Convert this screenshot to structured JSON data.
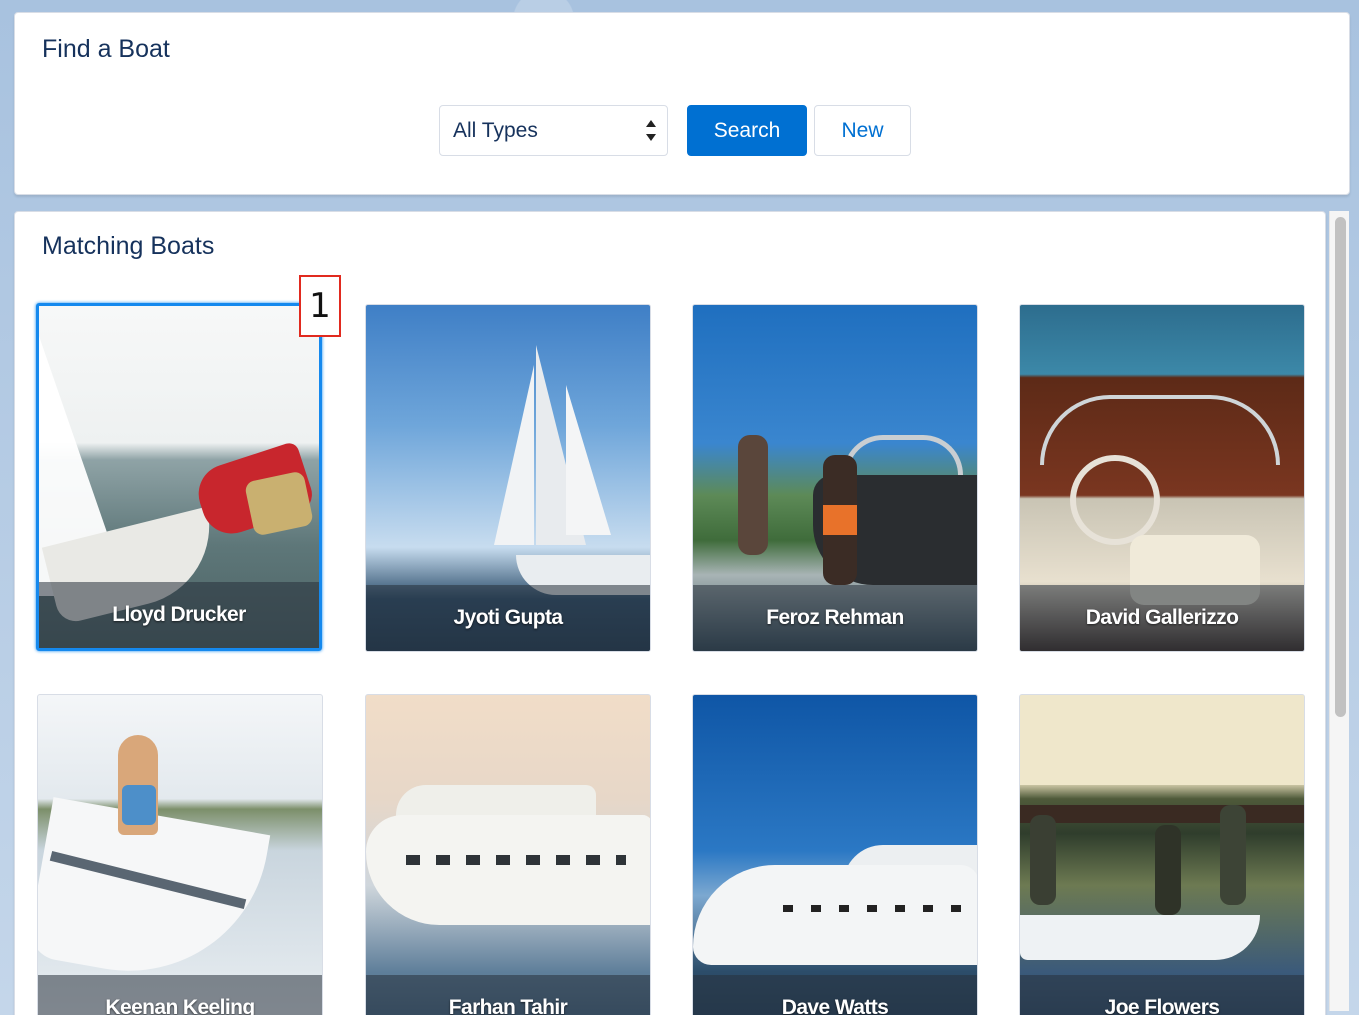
{
  "finder": {
    "title": "Find a Boat",
    "type_select": {
      "value": "All Types"
    },
    "search_label": "Search",
    "new_label": "New"
  },
  "results": {
    "title": "Matching Boats",
    "boats": [
      {
        "name": "Lloyd Drucker",
        "selected": true
      },
      {
        "name": "Jyoti Gupta"
      },
      {
        "name": "Feroz Rehman"
      },
      {
        "name": "David Gallerizzo"
      },
      {
        "name": "Keenan Keeling"
      },
      {
        "name": "Farhan Tahir"
      },
      {
        "name": "Dave Watts"
      },
      {
        "name": "Joe Flowers"
      }
    ]
  },
  "annotation": {
    "marker": "1"
  },
  "colors": {
    "brand": "#0070d2",
    "selected_border": "#1589ee",
    "marker_border": "#e12a1f"
  }
}
